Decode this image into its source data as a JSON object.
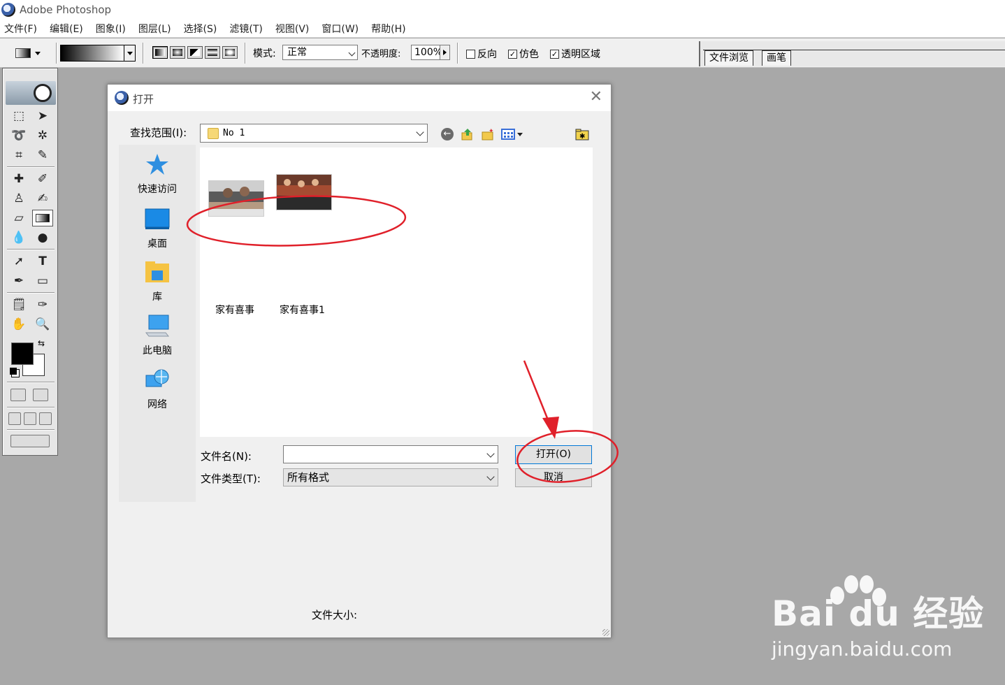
{
  "app": {
    "title": "Adobe Photoshop"
  },
  "menu": [
    "文件(F)",
    "编辑(E)",
    "图象(I)",
    "图层(L)",
    "选择(S)",
    "滤镜(T)",
    "视图(V)",
    "窗口(W)",
    "帮助(H)"
  ],
  "options_bar": {
    "mode_label": "模式:",
    "mode_value": "正常",
    "opacity_label": "不透明度:",
    "opacity_value": "100%",
    "reverse_label": "反向",
    "dither_label": "仿色",
    "transparency_label": "透明区域",
    "reverse_checked": false,
    "dither_checked": true,
    "transparency_checked": true
  },
  "palette_well": {
    "tabs": [
      "文件浏览",
      "画笔"
    ]
  },
  "dialog": {
    "title": "打开",
    "look_in_label": "查找范围(I):",
    "look_in_value": "No 1",
    "places": [
      "快速访问",
      "桌面",
      "库",
      "此电脑",
      "网络"
    ],
    "files": [
      "家有喜事",
      "家有喜事1"
    ],
    "file_name_label": "文件名(N):",
    "file_name_value": "",
    "file_type_label": "文件类型(T):",
    "file_type_value": "所有格式",
    "open_button": "打开(O)",
    "cancel_button": "取消",
    "file_size_label": "文件大小:"
  },
  "annotation_color": "#e0202a",
  "watermark": {
    "brand": "Bai du 经验",
    "url": "jingyan.baidu.com"
  }
}
